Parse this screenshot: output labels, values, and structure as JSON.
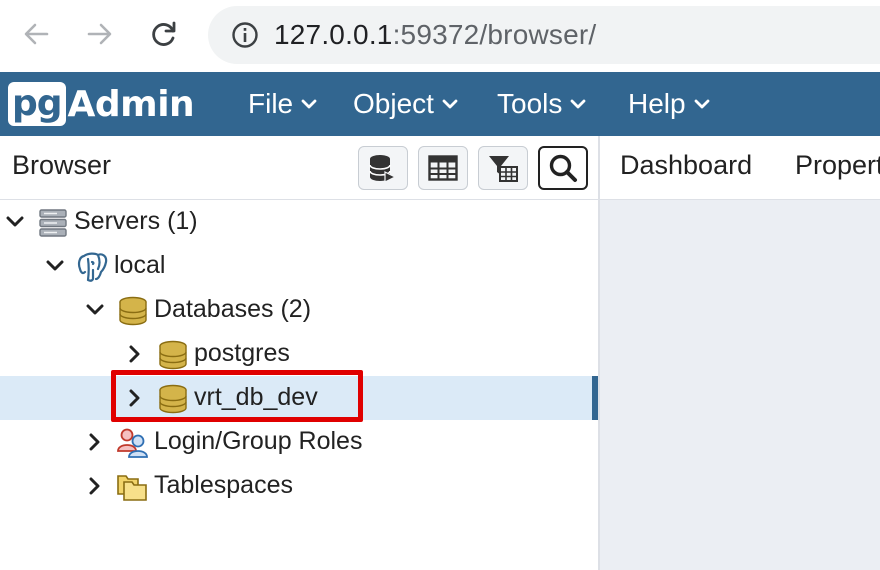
{
  "browser": {
    "url_host": "127.0.0.1",
    "url_rest": ":59372/browser/"
  },
  "app": {
    "logo_pg": "pg",
    "logo_admin": "Admin",
    "menus": [
      "File",
      "Object",
      "Tools",
      "Help"
    ]
  },
  "browser_panel": {
    "title": "Browser",
    "toolbar": [
      "query-tool-icon",
      "view-data-icon",
      "filtered-rows-icon",
      "search-objects-icon"
    ]
  },
  "right_tabs": [
    "Dashboard",
    "Properties"
  ],
  "tree": [
    {
      "label": "Servers (1)",
      "icon": "servers-icon",
      "expanded": true
    },
    {
      "label": "local",
      "icon": "postgres-elephant-icon",
      "expanded": true
    },
    {
      "label": "Databases (2)",
      "icon": "databases-icon",
      "expanded": true
    },
    {
      "label": "postgres",
      "icon": "database-icon",
      "expanded": false
    },
    {
      "label": "vrt_db_dev",
      "icon": "database-icon",
      "expanded": false,
      "selected": true
    },
    {
      "label": "Login/Group Roles",
      "icon": "roles-icon",
      "expanded": false
    },
    {
      "label": "Tablespaces",
      "icon": "tablespaces-icon",
      "expanded": false
    }
  ],
  "colors": {
    "navbar": "#326690",
    "selection": "#dbeaf7",
    "highlight": "#e00000"
  }
}
